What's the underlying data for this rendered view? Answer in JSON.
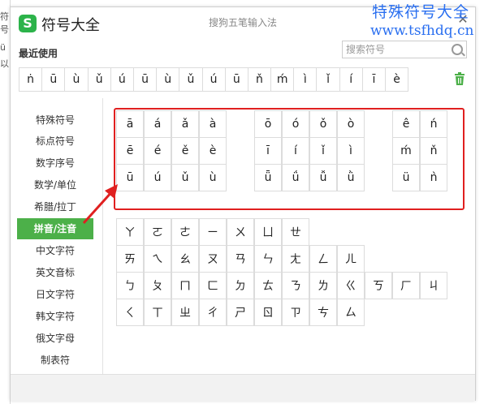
{
  "left_edge_text": [
    "符号",
    "ü",
    "以"
  ],
  "app": {
    "logo_letter": "S",
    "title": "符号大全",
    "ime_name": "搜狗五笔输入法",
    "close_label": "✕"
  },
  "watermark": {
    "line1": "特殊符号大全",
    "line2": "www.tsfhdq.cn"
  },
  "recent": {
    "label": "最近使用",
    "symbols": [
      "ṅ",
      "ū",
      "ù",
      "ǔ",
      "ú",
      "ū",
      "ù",
      "ǔ",
      "ú",
      "ū",
      "ň",
      "ḿ",
      "ì",
      "ǐ",
      "í",
      "ī",
      "è"
    ]
  },
  "search": {
    "placeholder": "搜索符号"
  },
  "sidebar": {
    "items": [
      {
        "label": "特殊符号"
      },
      {
        "label": "标点符号"
      },
      {
        "label": "数字序号"
      },
      {
        "label": "数学/单位"
      },
      {
        "label": "希腊/拉丁"
      },
      {
        "label": "拼音/注音"
      },
      {
        "label": "中文字符"
      },
      {
        "label": "英文音标"
      },
      {
        "label": "日文字符"
      },
      {
        "label": "韩文字符"
      },
      {
        "label": "俄文字母"
      },
      {
        "label": "制表符"
      }
    ],
    "active_label": "拼音/注音"
  },
  "pinyin": {
    "group_a": [
      "ā",
      "á",
      "ǎ",
      "à",
      "ē",
      "é",
      "ě",
      "è",
      "ū",
      "ú",
      "ǔ",
      "ù"
    ],
    "group_o": [
      "ō",
      "ó",
      "ǒ",
      "ò",
      "ī",
      "í",
      "ǐ",
      "ì",
      "ǖ",
      "ǘ",
      "ǚ",
      "ǜ"
    ],
    "group_e": [
      "ê",
      "ń",
      "ḿ",
      "ň",
      "ü",
      "ǹ"
    ]
  },
  "zhuyin": {
    "row1": [
      "ㄚ",
      "ㄛ",
      "ㄜ",
      "ㄧ",
      "ㄨ",
      "ㄩ",
      "ㄝ"
    ],
    "row2": [
      "ㄞ",
      "ㄟ",
      "ㄠ",
      "ㄡ",
      "ㄢ",
      "ㄣ",
      "ㄤ",
      "ㄥ",
      "ㄦ"
    ],
    "row3": [
      "ㄅ",
      "ㄆ",
      "ㄇ",
      "ㄈ",
      "ㄉ",
      "ㄊ",
      "ㄋ",
      "ㄌ",
      "ㄍ",
      "ㄎ",
      "ㄏ",
      "ㄐ"
    ],
    "row4": [
      "ㄑ",
      "ㄒ",
      "ㄓ",
      "ㄔ",
      "ㄕ",
      "ㄖ",
      "ㄗ",
      "ㄘ",
      "ㄙ"
    ]
  },
  "colors": {
    "accent": "#4cb049",
    "highlight_border": "#e02020",
    "watermark": "#2a6ff0"
  }
}
